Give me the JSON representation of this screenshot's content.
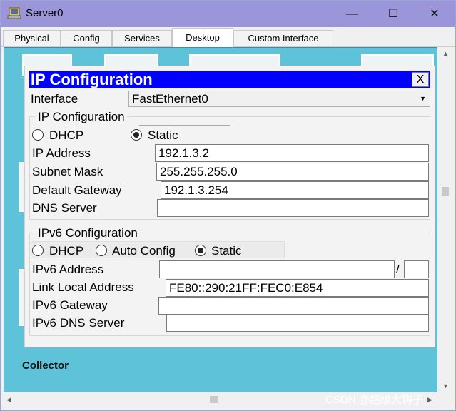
{
  "window": {
    "title": "Server0",
    "minimize_glyph": "—",
    "maximize_glyph": "☐",
    "close_glyph": "✕"
  },
  "tabs": [
    {
      "label": "Physical"
    },
    {
      "label": "Config"
    },
    {
      "label": "Services"
    },
    {
      "label": "Desktop",
      "active": true
    },
    {
      "label": "Custom Interface"
    }
  ],
  "desktop": {
    "background_color": "#5ec3d8",
    "partial_label": "Collector"
  },
  "ip_config": {
    "title": "IP Configuration",
    "close_label": "X",
    "interface_label": "Interface",
    "interface_value": "FastEthernet0",
    "ipv4": {
      "group_title": "IP Configuration",
      "dhcp_label": "DHCP",
      "static_label": "Static",
      "selected_mode": "Static",
      "ip_address_label": "IP Address",
      "ip_address_value": "192.1.3.2",
      "subnet_mask_label": "Subnet Mask",
      "subnet_mask_value": "255.255.255.0",
      "gateway_label": "Default Gateway",
      "gateway_value": "192.1.3.254",
      "dns_label": "DNS Server",
      "dns_value": ""
    },
    "ipv6": {
      "group_title": "IPv6 Configuration",
      "dhcp_label": "DHCP",
      "auto_label": "Auto Config",
      "static_label": "Static",
      "selected_mode": "Static",
      "address_label": "IPv6 Address",
      "address_value": "",
      "prefix_separator": "/",
      "prefix_value": "",
      "link_local_label": "Link Local Address",
      "link_local_value": "FE80::290:21FF:FEC0:E854",
      "gateway_label": "IPv6 Gateway",
      "gateway_value": "",
      "dns_label": "IPv6 DNS Server",
      "dns_value": ""
    }
  },
  "watermark": "CSDN @超级大钩子",
  "icons": [
    "app-icon",
    "minimize-icon",
    "maximize-icon",
    "close-icon",
    "dropdown-arrow-icon"
  ]
}
